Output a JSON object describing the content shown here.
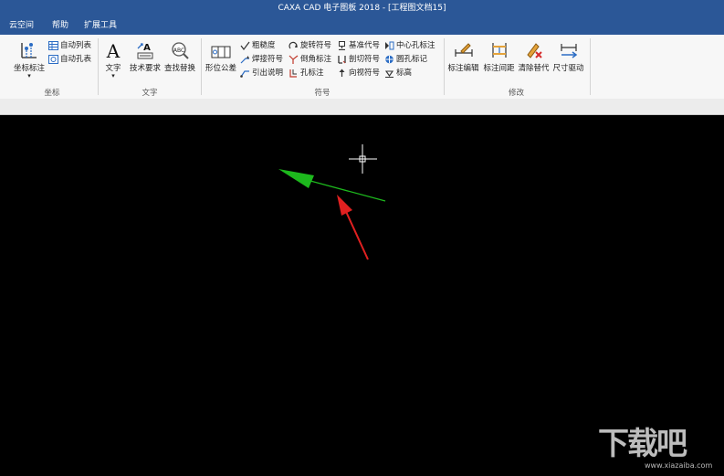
{
  "window": {
    "title": "CAXA CAD 电子图板 2018 - [工程图文档15]"
  },
  "menu": [
    "云空间",
    "帮助",
    "扩展工具"
  ],
  "ribbon": {
    "coord_group": {
      "label": "坐标",
      "coord_mark": "坐标标注",
      "auto_list": "自动列表",
      "auto_hole": "自动孔表"
    },
    "text_group": {
      "label": "文字",
      "text": "文字",
      "tech_req": "技术要求",
      "find_replace": "查找替换"
    },
    "symbol_group": {
      "label": "符号",
      "form_tol": "形位公差",
      "roughness": "粗糙度",
      "weld": "焊接符号",
      "leader": "引出说明",
      "rotate_sym": "旋转符号",
      "chamfer": "倒角标注",
      "hole": "孔标注",
      "datum": "基准代号",
      "cut": "剖切符号",
      "view_dir": "向视符号",
      "center_hole": "中心孔标注",
      "circle_mark": "圆孔标记",
      "elevation": "标高"
    },
    "modify_group": {
      "label": "修改",
      "dim_edit": "标注编辑",
      "dim_spacing": "标注间距",
      "clear_replace": "清除替代",
      "size_drive": "尺寸驱动"
    }
  },
  "canvas": {
    "background": "#000000",
    "leader_color": "#1db81d",
    "annotation_color": "#e02020"
  },
  "watermark": {
    "logo": "下载吧",
    "url": "www.xiazaiba.com"
  }
}
